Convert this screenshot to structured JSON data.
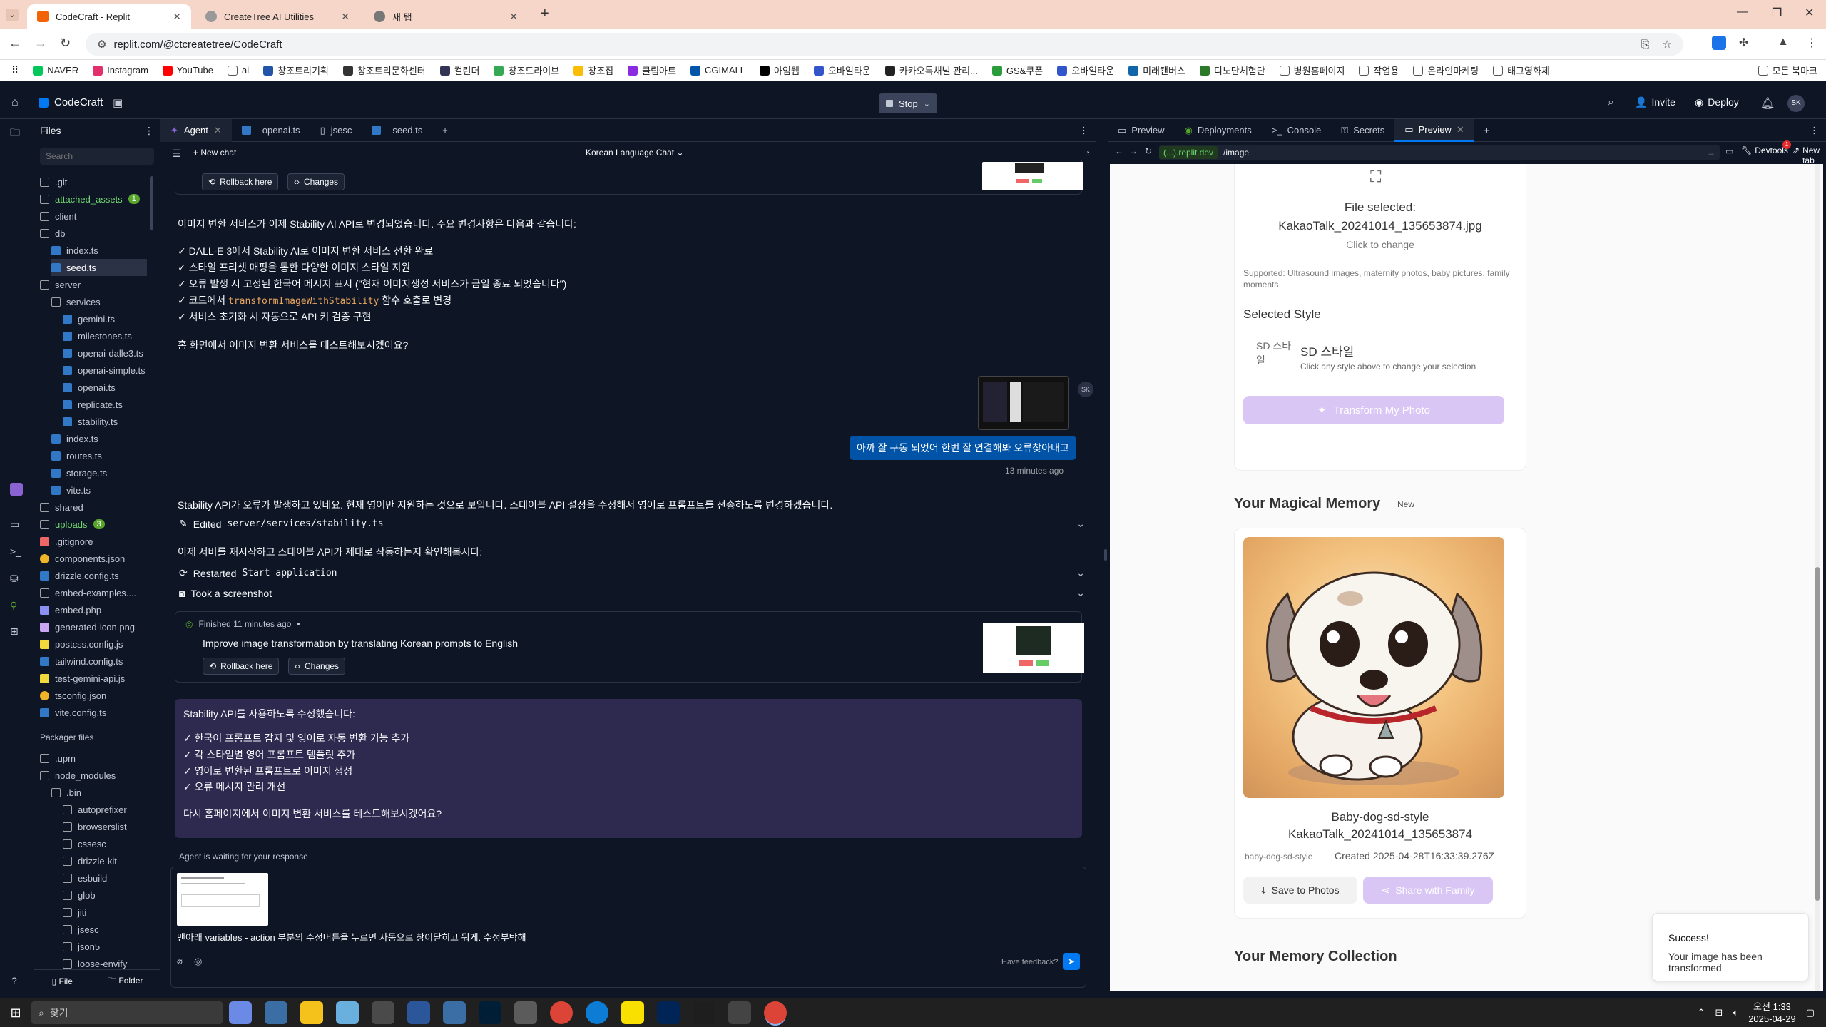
{
  "browser": {
    "tabs": [
      {
        "title": "CodeCraft - Replit",
        "active": true
      },
      {
        "title": "CreateTree AI Utilities",
        "active": false
      },
      {
        "title": "새 탭",
        "active": false
      }
    ],
    "url": "replit.com/@ctcreatetree/CodeCraft",
    "bookmarks": [
      "NAVER",
      "Instagram",
      "YouTube",
      "ai",
      "창조트리기획",
      "창조트리문화센터",
      "컬린더",
      "창조드라이브",
      "창조집",
      "클립아트",
      "CGIMALL",
      "아임웹",
      "오바일타운",
      "카카오톡채널 관리...",
      "GS&쿠폰",
      "오바일타운",
      "미래캔버스",
      "디노단체험단",
      "병원홈페이지",
      "작업용",
      "온라인마케팅",
      "태그영화제"
    ],
    "all_bookmarks": "모든 북마크"
  },
  "replit": {
    "app_name": "CodeCraft",
    "stop_label": "Stop",
    "invite_label": "Invite",
    "deploy_label": "Deploy",
    "avatar_initials": "SK"
  },
  "files": {
    "title": "Files",
    "search_placeholder": "Search",
    "items": [
      {
        "name": ".git",
        "type": "folder",
        "depth": 0
      },
      {
        "name": "attached_assets",
        "type": "folder",
        "depth": 0,
        "badge": "1",
        "color": "green"
      },
      {
        "name": "client",
        "type": "folder",
        "depth": 0
      },
      {
        "name": "db",
        "type": "folder",
        "depth": 0
      },
      {
        "name": "index.ts",
        "type": "ts",
        "depth": 1
      },
      {
        "name": "seed.ts",
        "type": "ts",
        "depth": 1,
        "selected": true
      },
      {
        "name": "server",
        "type": "folder",
        "depth": 0
      },
      {
        "name": "services",
        "type": "folder",
        "depth": 1
      },
      {
        "name": "gemini.ts",
        "type": "ts",
        "depth": 2
      },
      {
        "name": "milestones.ts",
        "type": "ts",
        "depth": 2
      },
      {
        "name": "openai-dalle3.ts",
        "type": "ts",
        "depth": 2
      },
      {
        "name": "openai-simple.ts",
        "type": "ts",
        "depth": 2
      },
      {
        "name": "openai.ts",
        "type": "ts",
        "depth": 2
      },
      {
        "name": "replicate.ts",
        "type": "ts",
        "depth": 2
      },
      {
        "name": "stability.ts",
        "type": "ts",
        "depth": 2
      },
      {
        "name": "index.ts",
        "type": "ts",
        "depth": 1
      },
      {
        "name": "routes.ts",
        "type": "ts",
        "depth": 1
      },
      {
        "name": "storage.ts",
        "type": "ts",
        "depth": 1
      },
      {
        "name": "vite.ts",
        "type": "ts",
        "depth": 1
      },
      {
        "name": "shared",
        "type": "folder",
        "depth": 0
      },
      {
        "name": "uploads",
        "type": "folder",
        "depth": 0,
        "badge": "3",
        "color": "green"
      },
      {
        "name": ".gitignore",
        "type": "git",
        "depth": 0
      },
      {
        "name": "components.json",
        "type": "json",
        "depth": 0
      },
      {
        "name": "drizzle.config.ts",
        "type": "ts",
        "depth": 0
      },
      {
        "name": "embed-examples....",
        "type": "folder",
        "depth": 0
      },
      {
        "name": "embed.php",
        "type": "php",
        "depth": 0
      },
      {
        "name": "generated-icon.png",
        "type": "png",
        "depth": 0
      },
      {
        "name": "postcss.config.js",
        "type": "js",
        "depth": 0
      },
      {
        "name": "tailwind.config.ts",
        "type": "ts",
        "depth": 0
      },
      {
        "name": "test-gemini-api.js",
        "type": "js",
        "depth": 0
      },
      {
        "name": "tsconfig.json",
        "type": "json",
        "depth": 0
      },
      {
        "name": "vite.config.ts",
        "type": "ts",
        "depth": 0
      }
    ],
    "packager_title": "Packager files",
    "packager_items": [
      {
        "name": ".upm",
        "depth": 0
      },
      {
        "name": "node_modules",
        "depth": 0
      },
      {
        "name": ".bin",
        "depth": 1
      },
      {
        "name": "autoprefixer",
        "depth": 2
      },
      {
        "name": "browserslist",
        "depth": 2
      },
      {
        "name": "cssesc",
        "depth": 2
      },
      {
        "name": "drizzle-kit",
        "depth": 2
      },
      {
        "name": "esbuild",
        "depth": 2
      },
      {
        "name": "glob",
        "depth": 2
      },
      {
        "name": "jiti",
        "depth": 2
      },
      {
        "name": "jsesc",
        "depth": 2
      },
      {
        "name": "json5",
        "depth": 2
      },
      {
        "name": "loose-envify",
        "depth": 2
      }
    ],
    "new_file_label": "File",
    "new_folder_label": "Folder"
  },
  "agent": {
    "tabs": [
      "Agent",
      "openai.ts",
      "jsesc",
      "seed.ts"
    ],
    "new_chat_label": "New chat",
    "chat_title": "Korean Language Chat",
    "rollback_label": "Rollback here",
    "changes_label": "Changes",
    "msg1_intro": "이미지 변환 서비스가 이제 Stability AI API로 변경되었습니다. 주요 변경사항은 다음과 같습니다:",
    "msg1_items": [
      "✓ DALL-E 3에서 Stability AI로 이미지 변환 서비스 전환 완료",
      "✓ 스타일 프리셋 매핑을 통한 다양한 이미지 스타일 지원",
      "✓ 오류 발생 시 고정된 한국어 메시지 표시 (\"현재 이미지생성 서비스가 금일 종료 되었습니다\")"
    ],
    "msg1_code_prefix": "✓ 코드에서 ",
    "msg1_code": "transformImageWithStability",
    "msg1_code_suffix": " 함수 호출로 변경",
    "msg1_last": "✓ 서비스 초기화 시 자동으로 API 키 검증 구현",
    "msg1_question": "홈 화면에서 이미지 변환 서비스를 테스트해보시겠어요?",
    "user_msg": "아까 잘 구동 되었어 한번 잘 연결해봐 오류찾아내고",
    "user_time": "13 minutes ago",
    "user_initials": "SK",
    "msg2": "Stability API가 오류가 발생하고 있네요. 현재 영어만 지원하는 것으로 보입니다. 스테이블 API 설정을 수정해서 영어로 프롬프트를 전송하도록 변경하겠습니다.",
    "edited_label": "Edited",
    "edited_file": "server/services/stability.ts",
    "msg3": "이제 서버를 재시작하고 스테이블 API가 제대로 작동하는지 확인해봅시다:",
    "restarted_label": "Restarted",
    "restarted_target": "Start application",
    "screenshot_label": "Took a screenshot",
    "finished_label": "Finished 11 minutes ago",
    "finished_title": "Improve image transformation by translating Korean prompts to English",
    "final_intro": "Stability API를 사용하도록 수정했습니다:",
    "final_items": [
      "✓ 한국어 프롬프트 감지 및 영어로 자동 변환 기능 추가",
      "✓ 각 스타일별 영어 프롬프트 템플릿 추가",
      "✓ 영어로 변환된 프롬프트로 이미지 생성",
      "✓ 오류 메시지 관리 개선"
    ],
    "final_question": "다시 홈페이지에서 이미지 변환 서비스를 테스트해보시겠어요?",
    "waiting": "Agent is waiting for your response",
    "input_text": "맨아래 variables - action 부분의 수정버튼을 누르면 자동으로 창이닫히고 뭐게. 수정부탁해",
    "feedback": "Have feedback?"
  },
  "preview": {
    "tabs": [
      "Preview",
      "Deployments",
      "Console",
      "Secrets",
      "Preview"
    ],
    "url_host": "(...).replit.dev",
    "url_path": "/image",
    "devtools_label": "Devtools",
    "devtools_badge": "1",
    "newtab_label": "New tab",
    "file_selected_label": "File selected:",
    "file_name": "KakaoTalk_20241014_135653874.jpg",
    "click_change": "Click to change",
    "supported": "Supported: Ultrasound images, maternity photos, baby pictures, family moments",
    "selected_style_title": "Selected Style",
    "style_alt": "SD 스타일",
    "style_name": "SD 스타일",
    "style_hint": "Click any style above to change your selection",
    "transform_btn": "Transform My Photo",
    "memory_title": "Your Magical Memory",
    "memory_badge": "New",
    "result_title_line1": "Baby-dog-sd-style",
    "result_title_line2": "KakaoTalk_20241014_135653874",
    "result_tag": "baby-dog-sd-style",
    "result_created": "Created 2025-04-28T16:33:39.276Z",
    "save_btn": "Save to Photos",
    "share_btn": "Share with Family",
    "collection_title": "Your Memory Collection",
    "toast_title": "Success!",
    "toast_body": "Your image has been transformed",
    "colors": {
      "accent": "#c9b4ef",
      "brand": "#0079f2"
    }
  },
  "taskbar": {
    "search_placeholder": "찾기",
    "time": "오전 1:33",
    "date": "2025-04-29"
  }
}
